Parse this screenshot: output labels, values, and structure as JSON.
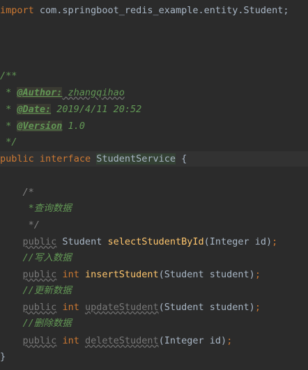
{
  "code": {
    "import_kw": "import",
    "import_path": " com.springboot_redis_example.entity.Student;",
    "doc_open": "/**",
    "doc_star": " * ",
    "author_tag": "@Author:",
    "author_val": " zhangqihao",
    "date_tag": "@Date:",
    "date_val": " 2019/4/11 20:52",
    "version_tag": "@Version",
    "version_val": " 1.0",
    "doc_close": " */",
    "public_kw": "public",
    "interface_kw": "interface",
    "iface_name": "StudentService",
    "open_brace": " {",
    "cmt_open": "/*",
    "cmt_query": " *查询数据",
    "cmt_close": " */",
    "m1_ret": " Student ",
    "m1_name": "selectStudentById",
    "m1_params": "(Integer id)",
    "semi": ";",
    "cmt_insert": "//写入数据",
    "int_kw": "int",
    "m2_name": "insertStudent",
    "m2_params": "(Student student)",
    "cmt_update": "//更新数据",
    "m3_name": "updateStudent",
    "m3_params": "(Student student)",
    "cmt_delete": "//删除数据",
    "m4_name": "deleteStudent",
    "m4_params": "(Integer id)",
    "close_brace": "}"
  }
}
